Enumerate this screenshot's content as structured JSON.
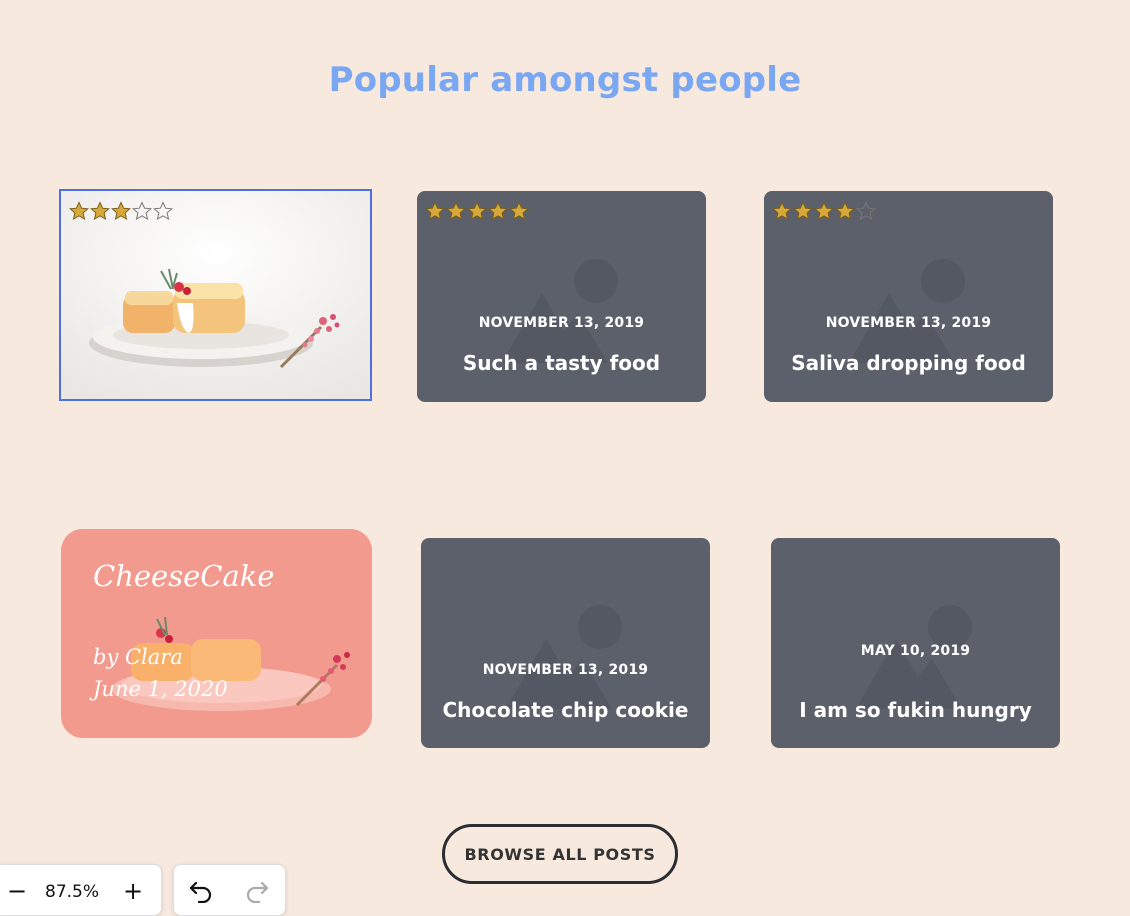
{
  "section": {
    "title": "Popular amongst people"
  },
  "cards": [
    {
      "kind": "image",
      "rating": 3,
      "selected": true
    },
    {
      "kind": "placeholder",
      "rating": 5,
      "date": "NOVEMBER 13, 2019",
      "title": "Such a tasty food"
    },
    {
      "kind": "placeholder",
      "rating": 4,
      "date": "NOVEMBER 13, 2019",
      "title": "Saliva dropping food"
    },
    {
      "kind": "featured",
      "title": "CheeseCake",
      "author": "by Clara",
      "date": "June 1, 2020"
    },
    {
      "kind": "placeholder",
      "date": "NOVEMBER 13, 2019",
      "title": "Chocolate chip cookie"
    },
    {
      "kind": "placeholder",
      "date": "MAY 10, 2019",
      "title": "I am so fukin hungry"
    }
  ],
  "browse_button": {
    "label": "BROWSE ALL POSTS"
  },
  "zoom": {
    "minus": "−",
    "value": "87.5%",
    "plus": "+"
  },
  "history": {
    "undo_icon": "undo-icon",
    "redo_icon": "redo-icon"
  },
  "colors": {
    "background": "#f8e9df",
    "title": "#7aa7f2",
    "card": "#5b606b",
    "featured": "#f39a8f",
    "star_fill": "#d7a93a",
    "selection": "#4d6fe0"
  }
}
